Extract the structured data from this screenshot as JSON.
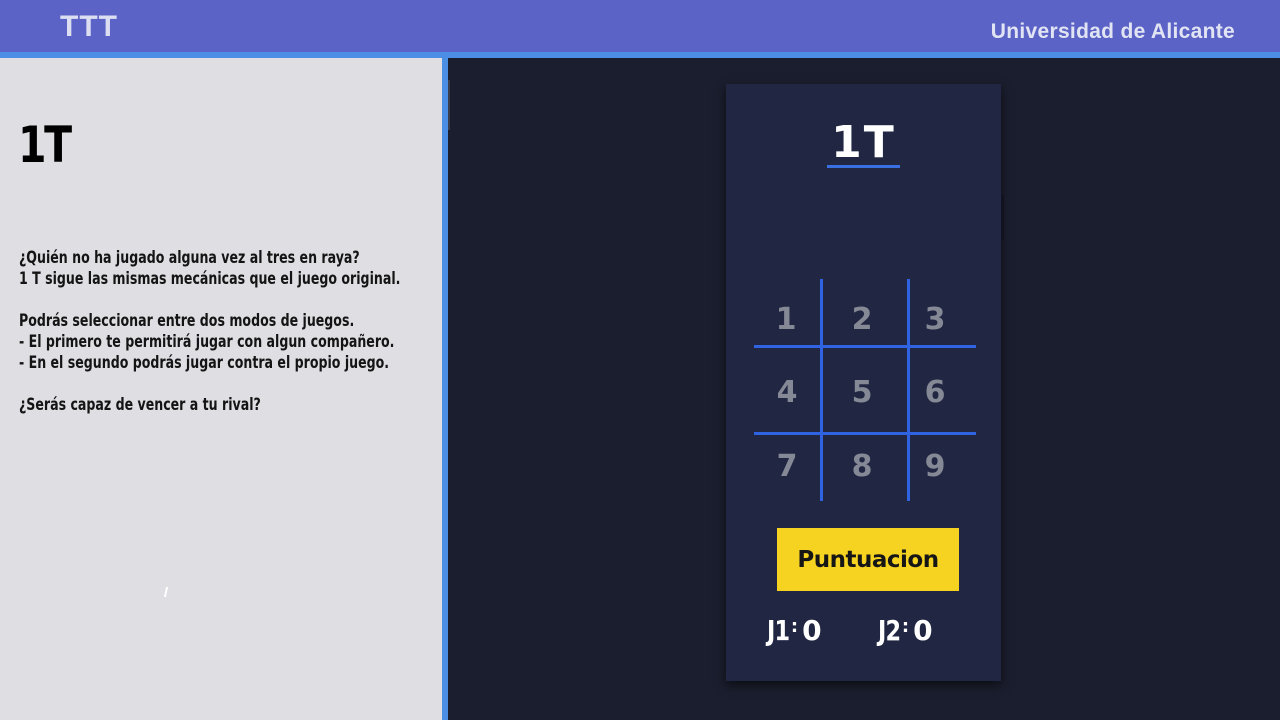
{
  "header": {
    "title": "TTT",
    "organization": "Universidad de Alicante"
  },
  "info": {
    "title": "1T",
    "lines": [
      "¿Quién no ha jugado alguna vez al tres en raya?",
      "1 T sigue las mismas mecánicas que el juego original.",
      "",
      "Podrás seleccionar entre dos modos de juegos.",
      "- El primero te permitirá jugar con algun compañero.",
      "- En el segundo podrás jugar contra el propio juego.",
      "",
      "¿Serás capaz de vencer a tu rival?"
    ]
  },
  "app": {
    "title": "1T",
    "cells": [
      "1",
      "2",
      "3",
      "4",
      "5",
      "6",
      "7",
      "8",
      "9"
    ],
    "score_button": "Puntuacion",
    "scores": [
      {
        "label": "J1",
        "separator": ":",
        "value": "0"
      },
      {
        "label": "J2",
        "separator": ":",
        "value": "0"
      }
    ]
  },
  "colors": {
    "header": "#5c63c6",
    "accent_blue": "#2f63e2",
    "button_yellow": "#f6d320",
    "phone_bg": "#212743",
    "stage_bg": "#1b1e2e",
    "panel_bg": "#dfdee3"
  }
}
